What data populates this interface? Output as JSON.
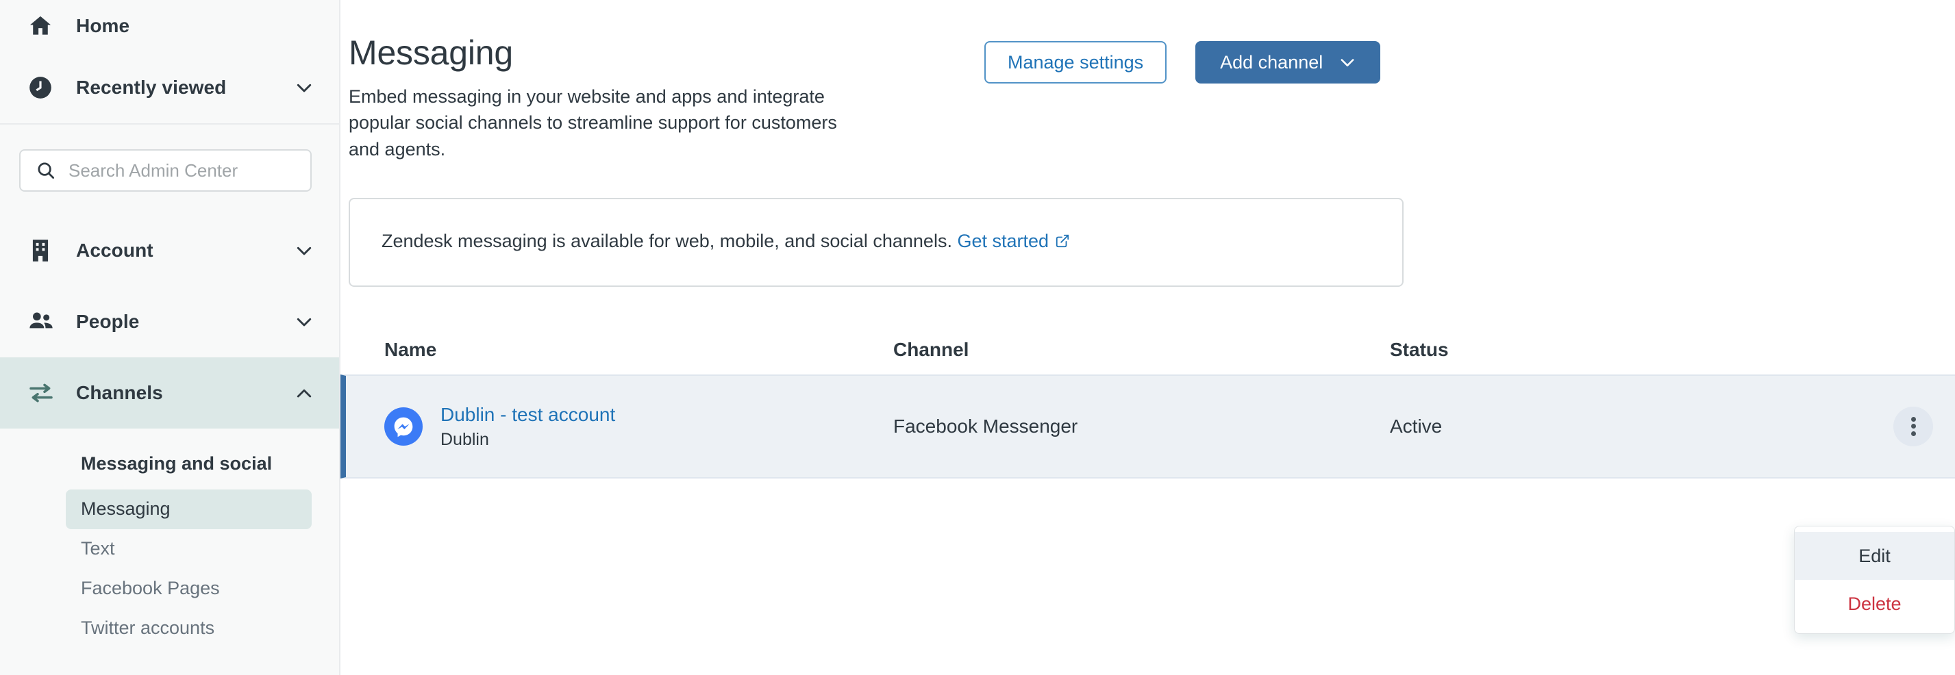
{
  "sidebar": {
    "primary_items": [
      {
        "label": "Home",
        "icon": "home-icon",
        "expandable": false
      },
      {
        "label": "Recently viewed",
        "icon": "clock-icon",
        "expandable": true,
        "chevron": "chevron-down"
      },
      {
        "label": "Account",
        "icon": "building-icon",
        "expandable": true,
        "chevron": "chevron-down"
      },
      {
        "label": "People",
        "icon": "people-icon",
        "expandable": true,
        "chevron": "chevron-down"
      },
      {
        "label": "Channels",
        "icon": "transfer-arrows-icon",
        "expandable": true,
        "chevron": "chevron-up",
        "active": true
      }
    ],
    "search": {
      "placeholder": "Search Admin Center",
      "value": "",
      "icon": "search-icon"
    },
    "subnav": {
      "header": "Messaging and social",
      "items": [
        {
          "label": "Messaging",
          "selected": true
        },
        {
          "label": "Text",
          "selected": false
        },
        {
          "label": "Facebook Pages",
          "selected": false
        },
        {
          "label": "Twitter accounts",
          "selected": false
        }
      ]
    }
  },
  "header": {
    "title": "Messaging",
    "description": "Embed messaging in your website and apps and integrate popular social channels to streamline support for customers and agents.",
    "manage_settings_label": "Manage settings",
    "add_channel_label": "Add channel"
  },
  "banner": {
    "text": "Zendesk messaging is available for web, mobile, and social channels.",
    "link_label": "Get started"
  },
  "table": {
    "columns": [
      "Name",
      "Channel",
      "Status"
    ],
    "rows": [
      {
        "icon": "facebook-messenger-icon",
        "name": "Dublin - test account",
        "subname": "Dublin",
        "channel": "Facebook Messenger",
        "status": "Active"
      }
    ]
  },
  "row_menu": {
    "items": [
      {
        "label": "Edit",
        "danger": false,
        "hovered": true,
        "highlighted": true
      },
      {
        "label": "Delete",
        "danger": true,
        "hovered": false,
        "highlighted": false
      }
    ]
  },
  "colors": {
    "accent_blue": "#1f73b7",
    "primary_button": "#3a6fa5",
    "sidebar_active": "#dce8e7",
    "row_selected_bg": "#edf1f5",
    "row_left_border": "#3a6fa5",
    "danger": "#cc3340",
    "highlight_outline": "#e8442a",
    "messenger_blue": "#3b7bf6",
    "text_primary": "#2f3941",
    "text_muted": "#68737d"
  }
}
